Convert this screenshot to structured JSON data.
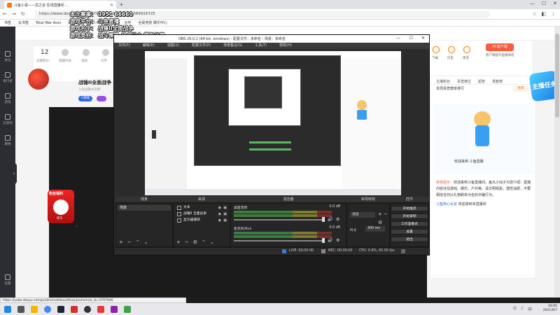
{
  "browser": {
    "tab_title": "斗鱼小说——龙之谷  在线直播间 ...",
    "url": "https://www.douyu.com/37979467_r=0.0260092089916725",
    "bookmarks": [
      "书签",
      "云书签",
      "Total War Asso",
      "网上商城",
      "个人中心",
      "游戏",
      "合作",
      "全民竞技 娱乐中心"
    ],
    "status_url": "https://yuba.douyu.com/p/uhlicksdsfwuulhhzy/p/uhxmcb_id=3797946"
  },
  "overlay": {
    "line1": "本次赛事：  3951 66660",
    "line2": "游戏平台：  斗鱼直播",
    "line3": "游戏名字：  战锤II全面战争",
    "line4": "游戏类别：  战斗策略 战术回合 模拟经营"
  },
  "douyu": {
    "leftnav": [
      "关注",
      "排行榜",
      "游戏",
      "云游戏",
      "赛事",
      "设置"
    ],
    "follow_count": "12",
    "follow_label": "主播积分",
    "room_icons": [
      "直播开关",
      "道具",
      "分享"
    ],
    "streamer_name": "战锤II全面战争",
    "streamer_sub": "斗鱼战锤水友群",
    "badge_blue": "V领域",
    "right_header_labels": [
      "下载",
      "历史",
      "更多"
    ],
    "pc_button": "PC客户端",
    "pc_sub": "客户端提升直播体验",
    "tabs": [
      "主播粉丝",
      "贵宾席位",
      "超管",
      "贡献榜"
    ],
    "rank_text": "本周贵宾榜单排行",
    "rank_btn": "贵宾",
    "mascot_caption": "欢迎来到 斗鱼直播",
    "chat": {
      "sys_label": "系统提示：",
      "sys_text": "欢迎来到斗鱼直播间，鱼丸小仙子为您介绍：直播内容涉及游戏、娱乐、户外等。请文明观看，理性消费，不要相信任何以礼物刷单为名的诈骗行为。",
      "user": "斗鱼热心水友",
      "user_text": "欢迎来到本直播间"
    },
    "task_badge": "主播任务",
    "promo_title": "粉丝福利",
    "promo_count": "0/1"
  },
  "obs": {
    "title": "OBS 26.0.2 (64-bit, windows) - 配置文件：未命名 - 场景：未命名",
    "menu": [
      "文件(F)",
      "编辑(E)",
      "视图(V)",
      "配置文件(P)",
      "场景集合(S)",
      "工具(T)",
      "帮助(H)"
    ],
    "docks": {
      "scenes": "场景",
      "sources": "来源",
      "mixer": "混音器",
      "transitions": "转场特效",
      "controls": "控件"
    },
    "scene_item": "场景",
    "sources": [
      "文本",
      "战锤II 全面战争",
      "显示器捕获"
    ],
    "mixer": [
      {
        "name": "桌面音频",
        "db": "0.0 dB"
      },
      {
        "name": "麦克风/Aux",
        "db": "0.0 dB"
      }
    ],
    "transition": "淡出",
    "duration_label": "时长",
    "duration": "300 ms",
    "controls": [
      "开始推流",
      "开始录制",
      "工作室模式",
      "设置",
      "退出"
    ],
    "status": {
      "live": "LIVE: 00:00:00",
      "rec": "REC: 00:00:00",
      "cpu": "CPU: 0.6%, 60.00 fps"
    }
  },
  "taskbar": {
    "time": "18:00",
    "date": "2021/9/7"
  },
  "colors": {
    "brand": "#ff7800",
    "obs_bg": "#2b2b2b",
    "accent_blue": "#2d6ae3"
  }
}
